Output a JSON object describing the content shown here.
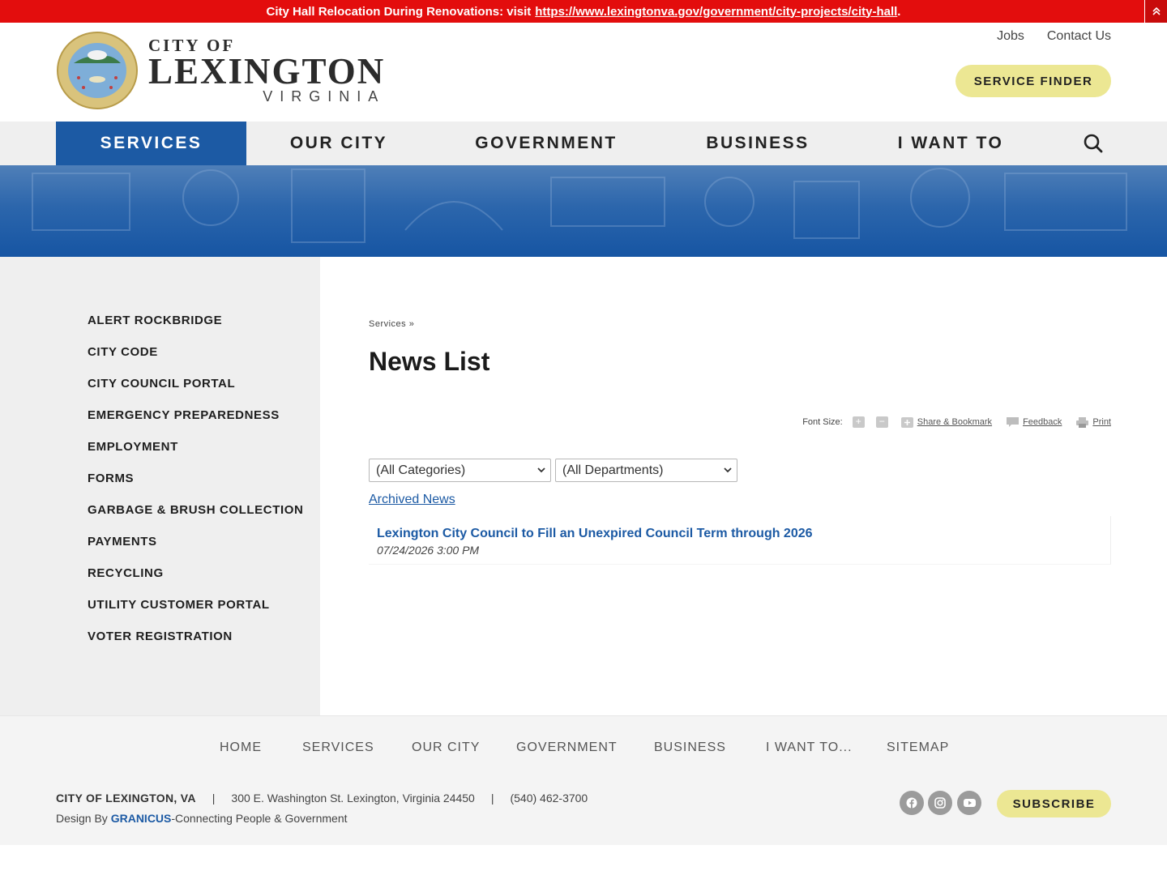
{
  "alert": {
    "text": "City Hall Relocation During Renovations: visit",
    "link": "https://www.lexingtonva.gov/government/city-projects/city-hall",
    "link_suffix": ".",
    "toggle_icon": "chevron-double-up-icon"
  },
  "header": {
    "logo": {
      "line1": "CITY OF",
      "line2": "LEXINGTON",
      "line3": "VIRGINIA"
    },
    "util_links": [
      "Jobs",
      "Contact Us"
    ],
    "service_finder": "SERVICE FINDER"
  },
  "nav": {
    "items": [
      "SERVICES",
      "OUR CITY",
      "GOVERNMENT",
      "BUSINESS",
      "I WANT TO"
    ],
    "active": "SERVICES",
    "search_icon": "search-icon"
  },
  "sidebar": {
    "items": [
      "ALERT ROCKBRIDGE",
      "CITY CODE",
      "CITY COUNCIL PORTAL",
      "EMERGENCY PREPAREDNESS",
      "EMPLOYMENT",
      "FORMS",
      "GARBAGE & BRUSH COLLECTION",
      "PAYMENTS",
      "RECYCLING",
      "UTILITY CUSTOMER PORTAL",
      "VOTER REGISTRATION"
    ]
  },
  "main": {
    "breadcrumb": "Services »",
    "title": "News List",
    "tools": {
      "font_size_label": "Font Size:",
      "increase": "+",
      "decrease": "−",
      "share": "Share & Bookmark",
      "feedback": "Feedback",
      "print": "Print"
    },
    "filters": {
      "category": "(All Categories)",
      "department": "(All Departments)"
    },
    "archived_link": "Archived News",
    "news": [
      {
        "title": "Lexington City Council to Fill an Unexpired Council Term through 2026",
        "date": "07/24/2026 3:00 PM"
      }
    ]
  },
  "footer": {
    "nav": [
      "HOME",
      "SERVICES",
      "OUR CITY",
      "GOVERNMENT",
      "BUSINESS",
      "I WANT TO...",
      "SITEMAP"
    ],
    "org": "CITY OF LEXINGTON, VA",
    "separator": "|",
    "address": "300 E. Washington St. Lexington, Virginia 24450",
    "phone": "(540) 462-3700",
    "design_prefix": "Design By",
    "design_brand": "GRANICUS",
    "design_suffix": "-Connecting People & Government",
    "social": [
      "facebook-icon",
      "instagram-icon",
      "youtube-icon"
    ],
    "subscribe": "SUBSCRIBE"
  }
}
